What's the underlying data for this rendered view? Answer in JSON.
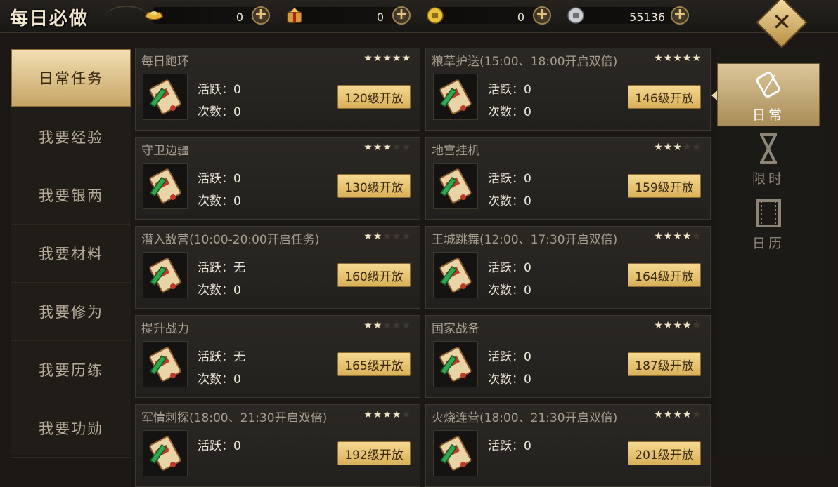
{
  "window": {
    "title": "每日必做"
  },
  "currencies": [
    {
      "icon": "gold-ingot-icon",
      "value": "0"
    },
    {
      "icon": "gift-pouch-icon",
      "value": "0"
    },
    {
      "icon": "gold-coin-icon",
      "value": "0"
    },
    {
      "icon": "silver-coin-icon",
      "value": "55136"
    }
  ],
  "plus_label": "+",
  "close_label": "✕",
  "sidebar": {
    "items": [
      {
        "label": "日常任务",
        "active": true
      },
      {
        "label": "我要经验",
        "active": false
      },
      {
        "label": "我要银两",
        "active": false
      },
      {
        "label": "我要材料",
        "active": false
      },
      {
        "label": "我要修为",
        "active": false
      },
      {
        "label": "我要历练",
        "active": false
      },
      {
        "label": "我要功勋",
        "active": false
      }
    ]
  },
  "stat_labels": {
    "active": "活跃：",
    "count": "次数："
  },
  "tasks": [
    {
      "name": "每日跑环",
      "stars": 5,
      "active": "0",
      "count": "0",
      "button": "120级开放"
    },
    {
      "name": "粮草护送(15:00、18:00开启双倍)",
      "stars": 5,
      "active": "0",
      "count": "0",
      "button": "146级开放"
    },
    {
      "name": "守卫边疆",
      "stars": 3,
      "active": "0",
      "count": "0",
      "button": "130级开放"
    },
    {
      "name": "地宫挂机",
      "stars": 3,
      "active": "0",
      "count": "0",
      "button": "159级开放"
    },
    {
      "name": "潜入敌营(10:00-20:00开启任务)",
      "stars": 2,
      "active": "无",
      "count": "0",
      "button": "160级开放"
    },
    {
      "name": "王城跳舞(12:00、17:30开启双倍)",
      "stars": 4,
      "active": "0",
      "count": "0",
      "button": "164级开放"
    },
    {
      "name": "提升战力",
      "stars": 2,
      "active": "无",
      "count": "0",
      "button": "165级开放"
    },
    {
      "name": "国家战备",
      "stars": 4,
      "active": "0",
      "count": "0",
      "button": "187级开放"
    },
    {
      "name": "军情刺探(18:00、21:30开启双倍)",
      "stars": 4,
      "active": "0",
      "count": "",
      "button": "192级开放"
    },
    {
      "name": "火烧连营(18:00、21:30开启双倍)",
      "stars": 4,
      "active": "0",
      "count": "",
      "button": "201级开放"
    }
  ],
  "right_tabs": [
    {
      "label": "日常",
      "icon": "scroll-icon",
      "active": true
    },
    {
      "label": "限时",
      "icon": "hourglass-icon",
      "active": false
    },
    {
      "label": "日历",
      "icon": "calendar-icon",
      "active": false
    }
  ],
  "colors": {
    "accent_gold": "#d9b059",
    "star_on": "#efe4c8",
    "star_off": "#3e3a33"
  }
}
